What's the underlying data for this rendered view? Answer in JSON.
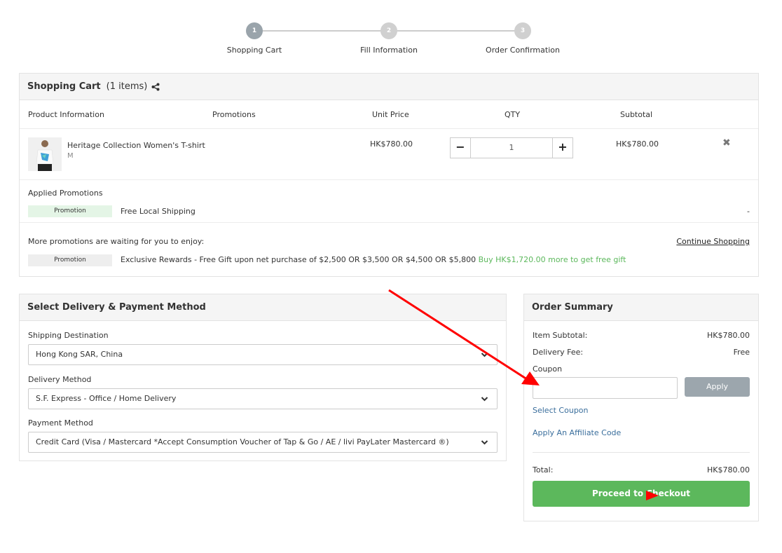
{
  "stepper": {
    "steps": [
      {
        "number": "1",
        "label": "Shopping Cart",
        "active": true
      },
      {
        "number": "2",
        "label": "Fill Information",
        "active": false
      },
      {
        "number": "3",
        "label": "Order Confirmation",
        "active": false
      }
    ]
  },
  "cart": {
    "title": "Shopping Cart",
    "count": "(1 items)",
    "columns": {
      "product": "Product Information",
      "promotions": "Promotions",
      "unit_price": "Unit Price",
      "qty": "QTY",
      "subtotal": "Subtotal"
    },
    "items": [
      {
        "name": "Heritage Collection Women's T-shirt",
        "variant": "M",
        "unit_price": "HK$780.00",
        "qty": "1",
        "subtotal": "HK$780.00"
      }
    ],
    "qty_minus": "−",
    "qty_plus": "+",
    "remove_glyph": "✖",
    "applied_promotions": {
      "title": "Applied Promotions",
      "tag": "Promotion",
      "text": "Free Local Shipping",
      "value": "-"
    },
    "more_promotions": {
      "title": "More promotions are waiting for you to enjoy:",
      "continue_label": "Continue Shopping",
      "tag": "Promotion",
      "text": "Exclusive Rewards - Free Gift upon net purchase of $2,500 OR $3,500 OR $4,500 OR $5,800",
      "highlight": "Buy HK$1,720.00 more to get free gift"
    }
  },
  "delivery": {
    "title": "Select Delivery & Payment Method",
    "fields": [
      {
        "label": "Shipping Destination",
        "value": "Hong Kong SAR, China"
      },
      {
        "label": "Delivery Method",
        "value": "S.F. Express - Office / Home Delivery"
      },
      {
        "label": "Payment Method",
        "value": "Credit Card (Visa / Mastercard *Accept Consumption Voucher of Tap & Go / AE / livi PayLater Mastercard ®)"
      }
    ]
  },
  "summary": {
    "title": "Order Summary",
    "item_subtotal_label": "Item Subtotal:",
    "item_subtotal_value": "HK$780.00",
    "delivery_fee_label": "Delivery Fee:",
    "delivery_fee_value": "Free",
    "coupon_label": "Coupon",
    "coupon_value": "",
    "apply_label": "Apply",
    "select_coupon": "Select Coupon",
    "affiliate_code": "Apply An Affiliate Code",
    "total_label": "Total:",
    "total_value": "HK$780.00",
    "checkout_label": "Proceed to Checkout"
  },
  "colors": {
    "accent_green": "#5cb85c",
    "link_blue": "#3a6e9c",
    "annotation_red": "#ff0000"
  }
}
